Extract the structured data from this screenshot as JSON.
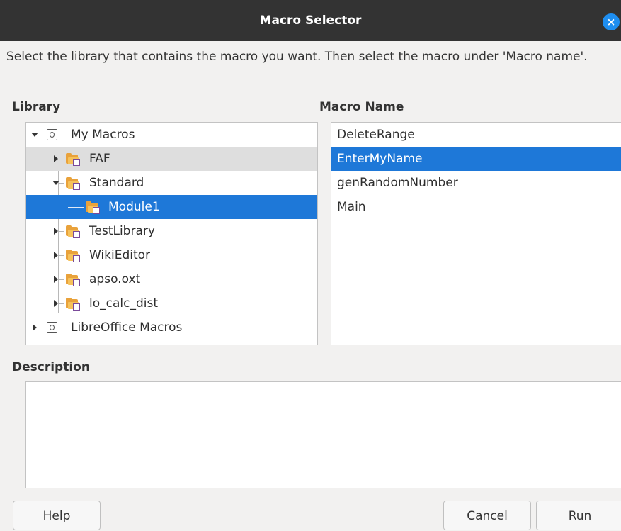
{
  "window": {
    "title": "Macro Selector",
    "close_symbol": "×"
  },
  "instructions": "Select the library that contains the macro you want. Then select the macro under 'Macro name'.",
  "library": {
    "label": "Library",
    "items": [
      {
        "label": "My Macros"
      },
      {
        "label": "FAF"
      },
      {
        "label": "Standard"
      },
      {
        "label": "Module1"
      },
      {
        "label": "TestLibrary"
      },
      {
        "label": "WikiEditor"
      },
      {
        "label": "apso.oxt"
      },
      {
        "label": "lo_calc_dist"
      },
      {
        "label": "LibreOffice Macros"
      }
    ]
  },
  "macro_name": {
    "label": "Macro Name",
    "items": [
      "DeleteRange",
      "EnterMyName",
      "genRandomNumber",
      "Main"
    ],
    "selected": "EnterMyName"
  },
  "description": {
    "label": "Description",
    "text": ""
  },
  "buttons": {
    "help": "Help",
    "cancel": "Cancel",
    "run": "Run"
  },
  "colors": {
    "selection": "#1e78d8",
    "titlebar": "#333333",
    "close_button": "#1e8ef0",
    "folder": "#e9a23b"
  }
}
